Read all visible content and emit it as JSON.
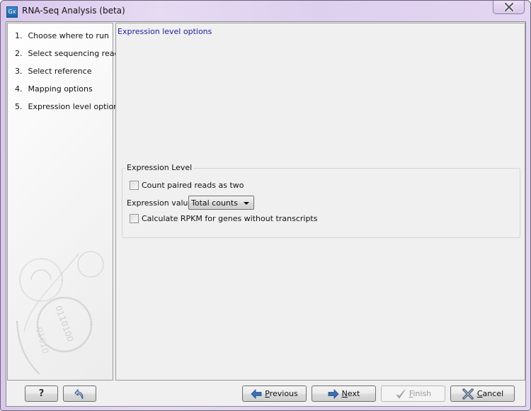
{
  "window": {
    "title": "RNA-Seq Analysis (beta)",
    "app_icon_text": "Gx",
    "close_icon": "close-icon"
  },
  "steps": [
    {
      "number": "1.",
      "label": "Choose where to run"
    },
    {
      "number": "2.",
      "label": "Select sequencing reads"
    },
    {
      "number": "3.",
      "label": "Select reference"
    },
    {
      "number": "4.",
      "label": "Mapping options"
    },
    {
      "number": "5.",
      "label": "Expression level options"
    }
  ],
  "content": {
    "heading": "Expression level options",
    "group": {
      "title": "Expression Level",
      "count_paired": {
        "label": "Count paired reads as two",
        "checked": false
      },
      "expression_value": {
        "label": "Expression value",
        "selected": "Total counts"
      },
      "rpkm": {
        "label": "Calculate RPKM for genes without transcripts",
        "checked": false
      }
    }
  },
  "buttons": {
    "help": {
      "label": "?",
      "icon": "help-icon"
    },
    "restore": {
      "icon": "restore-defaults-icon"
    },
    "previous": {
      "mnemonic": "P",
      "rest": "revious",
      "icon": "arrow-left-icon"
    },
    "next": {
      "mnemonic": "N",
      "rest": "ext",
      "icon": "arrow-right-icon"
    },
    "finish": {
      "mnemonic": "F",
      "rest": "inish",
      "icon": "checkmark-icon",
      "enabled": false
    },
    "cancel": {
      "mnemonic": "C",
      "rest": "ancel",
      "icon": "x-icon"
    }
  },
  "colors": {
    "heading": "#1a1aa6",
    "frame": "#e3d6f2",
    "arrow": "#3a6fb3"
  }
}
